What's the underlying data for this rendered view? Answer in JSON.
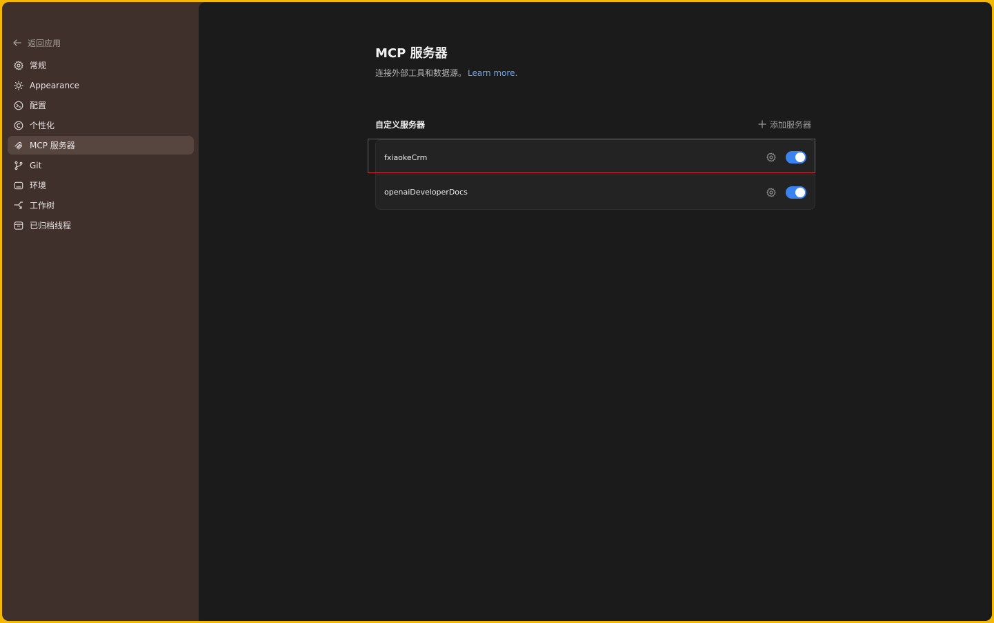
{
  "sidebar": {
    "back_label": "返回应用",
    "items": [
      {
        "label": "常规",
        "icon": "gear-icon"
      },
      {
        "label": "Appearance",
        "icon": "sun-icon"
      },
      {
        "label": "配置",
        "icon": "sliders-icon"
      },
      {
        "label": "个性化",
        "icon": "smile-icon"
      },
      {
        "label": "MCP 服务器",
        "icon": "plug-icon",
        "active": true
      },
      {
        "label": "Git",
        "icon": "git-branch-icon"
      },
      {
        "label": "环境",
        "icon": "monitor-icon"
      },
      {
        "label": "工作树",
        "icon": "worktree-icon"
      },
      {
        "label": "已归档线程",
        "icon": "archive-icon"
      }
    ]
  },
  "main": {
    "title": "MCP 服务器",
    "subtitle": "连接外部工具和数据源。",
    "learn_more": "Learn more.",
    "section_title": "自定义服务器",
    "add_server_label": "添加服务器",
    "servers": [
      {
        "name": "fxiaokeCrm",
        "enabled": true
      },
      {
        "name": "openaiDeveloperDocs",
        "enabled": true
      }
    ]
  },
  "colors": {
    "accent": "#3a82f0",
    "link": "#6aa7f5",
    "highlight": "#d8323b",
    "sidebar_bg": "#40302c",
    "main_bg": "#1b1b1b"
  }
}
